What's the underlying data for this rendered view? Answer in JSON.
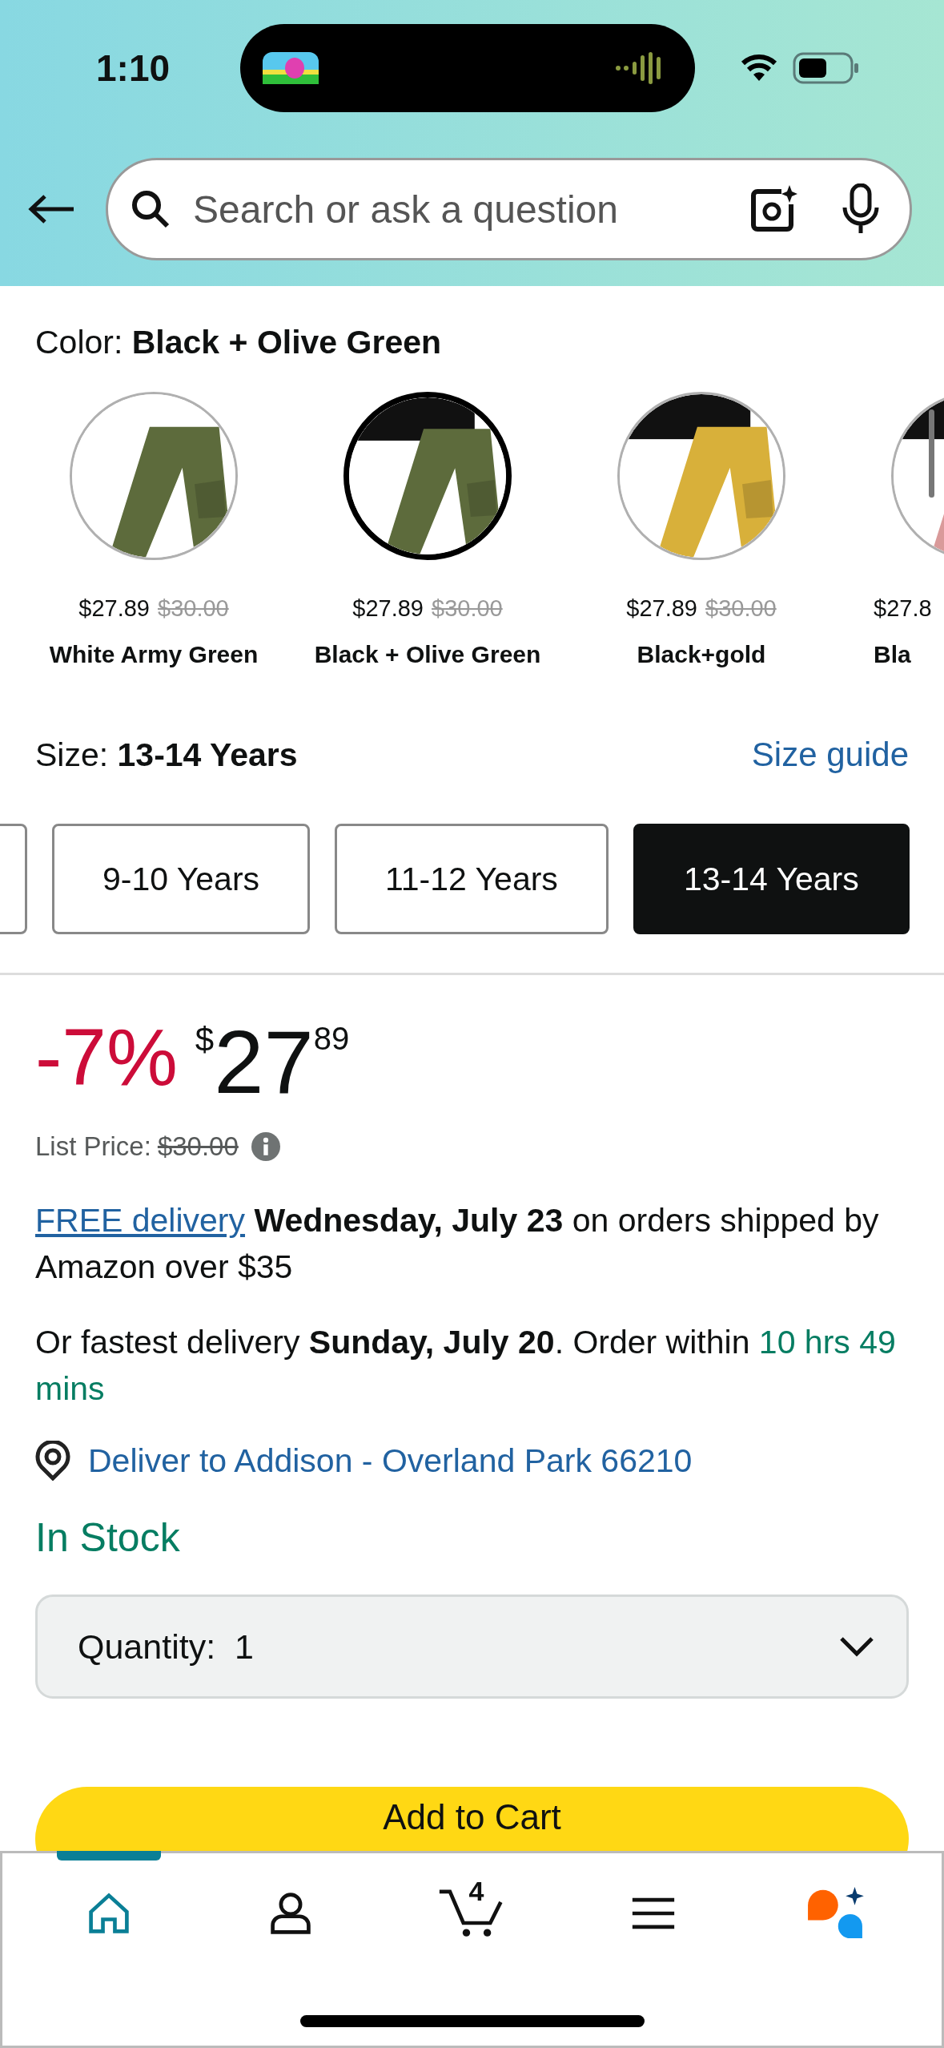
{
  "status_bar": {
    "time": "1:10"
  },
  "search": {
    "placeholder": "Search or ask a question"
  },
  "color": {
    "label": "Color: ",
    "value": "Black + Olive Green"
  },
  "swatches": [
    {
      "kind": "picture",
      "price": "$27.89",
      "list_price": "$30.00",
      "name": "White Army Green",
      "selected": false
    },
    {
      "kind": "picture",
      "price": "$27.89",
      "list_price": "$30.00",
      "name": "Black + Olive Green",
      "selected": true
    },
    {
      "kind": "picture",
      "price": "$27.89",
      "list_price": "$30.00",
      "name": "Black+gold",
      "selected": false
    },
    {
      "kind": "picture",
      "price": "$27.8",
      "name": "Bla",
      "selected": false
    }
  ],
  "size": {
    "label": "Size: ",
    "value": "13-14 Years",
    "guide": "Size guide"
  },
  "sizes": [
    {
      "selected": false
    },
    {
      "label": "9-10 Years",
      "selected": false
    },
    {
      "label": "11-12 Years",
      "selected": false
    },
    {
      "label": "13-14 Years",
      "selected": true
    }
  ],
  "price": {
    "discount": "-7%",
    "currency": "$",
    "whole": "27",
    "fraction": "89",
    "list_label": "List Price: ",
    "list_price": "$30.00"
  },
  "delivery": {
    "link": "FREE delivery",
    "text": " **Wednesday, July 23** on orders shipped by Amazon over $35"
  },
  "fastest": {
    "text": "Or fastest delivery **Sunday, July 20**. Order within ",
    "countdown": "10 hrs 49 mins"
  },
  "location": "Deliver to Addison - Overland Park 66210",
  "stock": "In Stock",
  "quantity": {
    "label": "Quantity:",
    "value": "1"
  },
  "add_to_cart": "Add to Cart",
  "nav": [
    {
      "kind": "home",
      "selected": true
    },
    {
      "kind": "account",
      "selected": false
    },
    {
      "kind": "cart",
      "count": "4",
      "selected": false
    },
    {
      "kind": "menu",
      "selected": false
    },
    {
      "kind": "assistant",
      "selected": false
    }
  ]
}
